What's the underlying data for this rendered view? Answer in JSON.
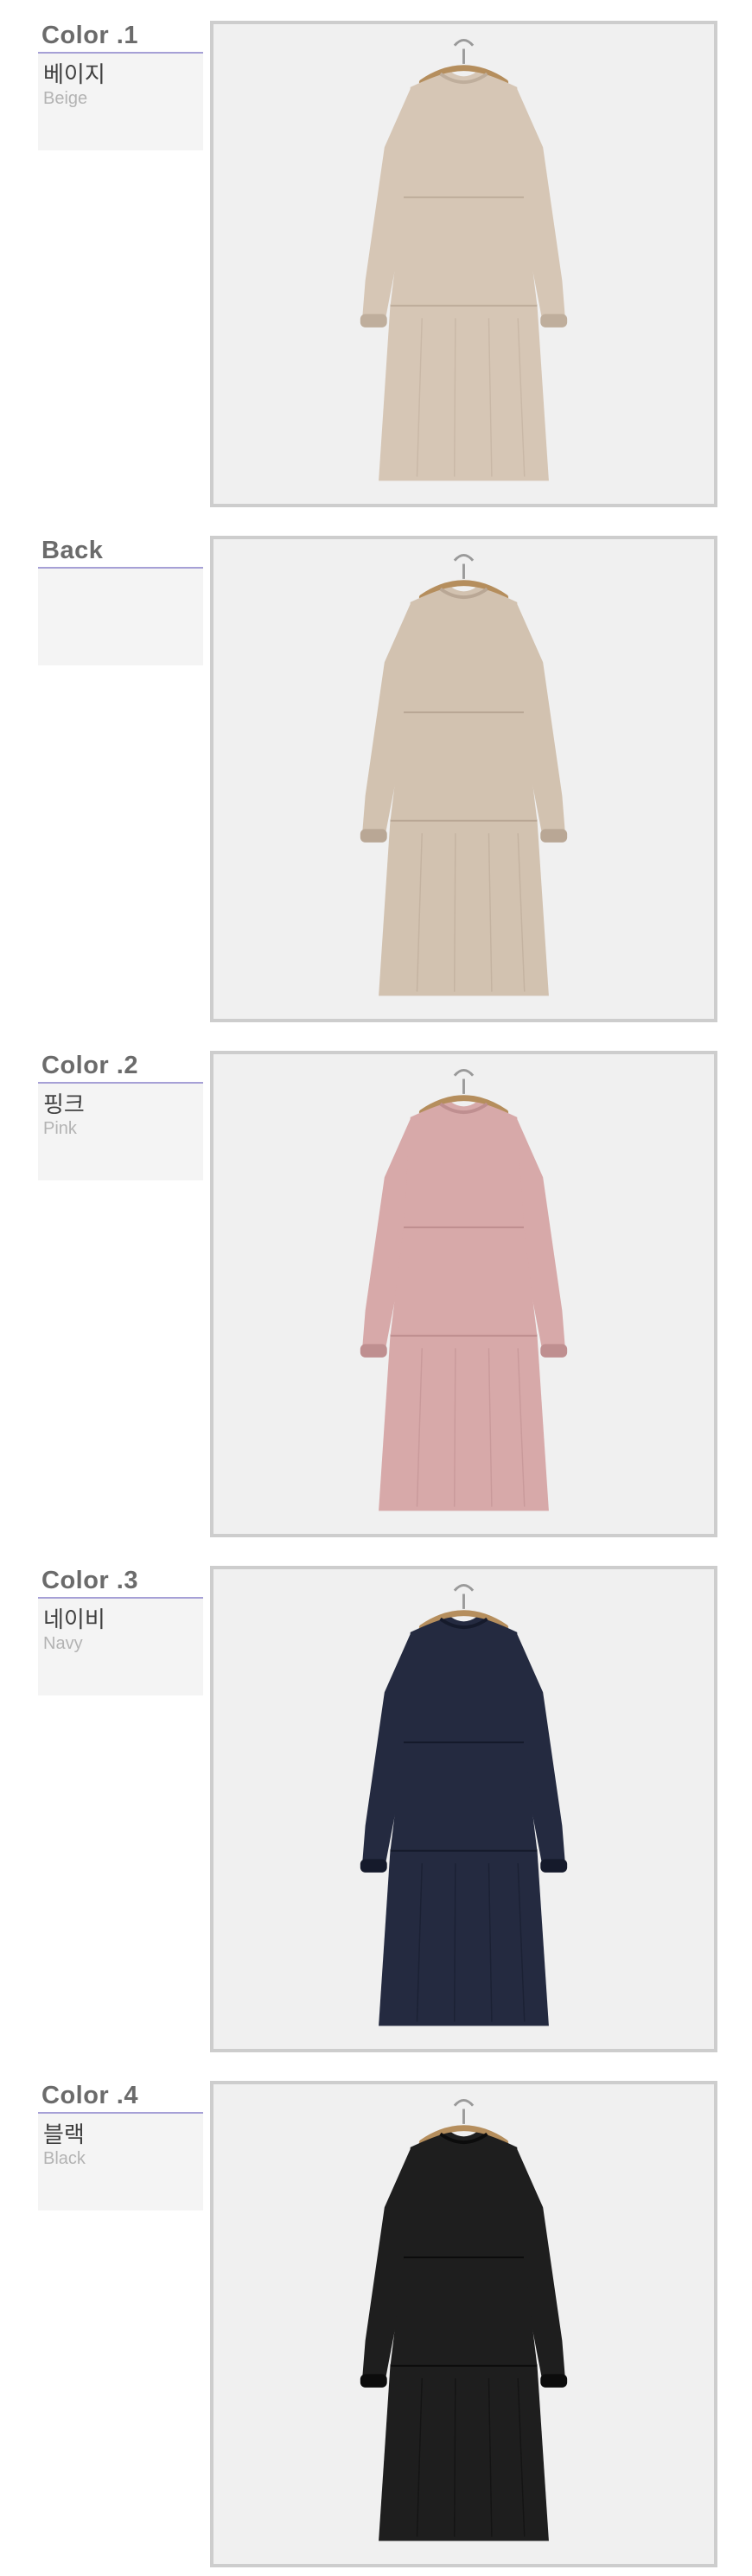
{
  "sections": [
    {
      "title": "Color .1",
      "name_ko": "베이지",
      "name_en": "Beige",
      "color": "#d6c6b5",
      "shade": "#bfae9c"
    },
    {
      "title": "Back",
      "name_ko": "",
      "name_en": "",
      "color": "#d2c2b0",
      "shade": "#b9a795"
    },
    {
      "title": "Color .2",
      "name_ko": "핑크",
      "name_en": "Pink",
      "color": "#d7a9a9",
      "shade": "#bf8f90"
    },
    {
      "title": "Color .3",
      "name_ko": "네이비",
      "name_en": "Navy",
      "color": "#242a40",
      "shade": "#151a2b"
    },
    {
      "title": "Color .4",
      "name_ko": "블랙",
      "name_en": "Black",
      "color": "#1e1e1e",
      "shade": "#0c0c0c"
    }
  ],
  "colors": {
    "accent_rule": "#a6a0d6",
    "label_panel_bg": "#f4f4f4",
    "frame_border": "#cdcdcd",
    "photo_bg": "#f0f0f0",
    "hanger": "#b58e5d"
  }
}
